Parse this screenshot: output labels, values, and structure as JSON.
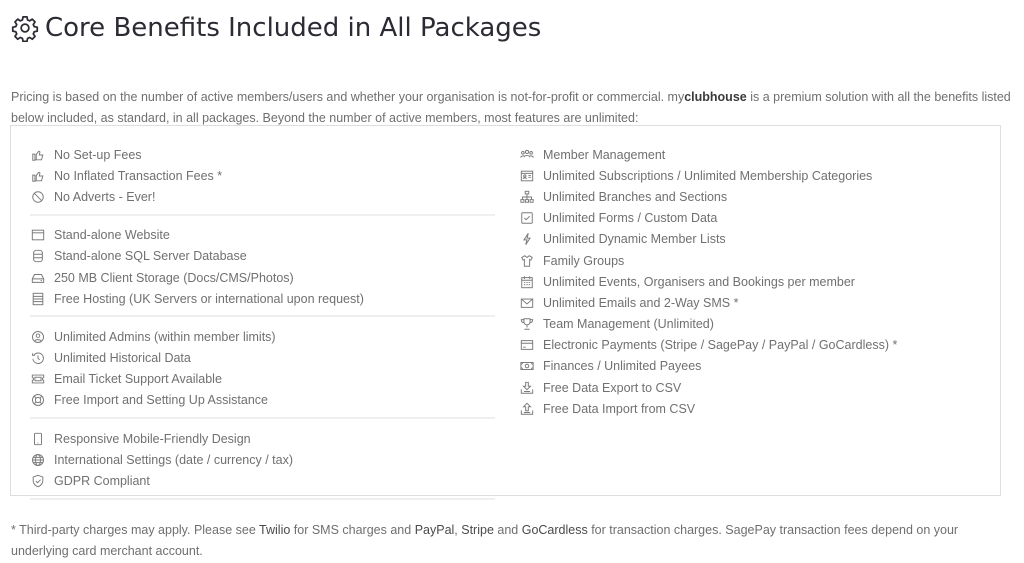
{
  "header": {
    "icon": "gear-icon",
    "title": "Core Benefits Included in All Packages"
  },
  "intro": {
    "part1": "Pricing is based on the number of active members/users and whether your organisation is not-for-profit or commercial. my",
    "brand": "clubhouse",
    "part2": " is a premium solution with all the benefits listed below included, as standard, in all packages. Beyond the number of active members, most features are unlimited:"
  },
  "left_column": {
    "groups": [
      {
        "items": [
          {
            "icon": "thumbs-up-icon",
            "label": "No Set-up Fees"
          },
          {
            "icon": "thumbs-up-icon",
            "label": "No Inflated Transaction Fees *"
          },
          {
            "icon": "ban-icon",
            "label": "No Adverts - Ever!"
          }
        ]
      },
      {
        "items": [
          {
            "icon": "browser-window-icon",
            "label": "Stand-alone Website"
          },
          {
            "icon": "database-icon",
            "label": "Stand-alone SQL Server Database"
          },
          {
            "icon": "hard-drive-icon",
            "label": "250 MB Client Storage (Docs/CMS/Photos)"
          },
          {
            "icon": "server-icon",
            "label": "Free Hosting (UK Servers or international upon request)"
          }
        ]
      },
      {
        "items": [
          {
            "icon": "user-circle-icon",
            "label": "Unlimited Admins (within member limits)"
          },
          {
            "icon": "history-icon",
            "label": "Unlimited Historical Data"
          },
          {
            "icon": "ticket-icon",
            "label": "Email Ticket Support Available"
          },
          {
            "icon": "lifebuoy-icon",
            "label": "Free Import and Setting Up Assistance"
          }
        ]
      },
      {
        "items": [
          {
            "icon": "mobile-icon",
            "label": "Responsive Mobile-Friendly Design"
          },
          {
            "icon": "globe-icon",
            "label": "International Settings (date / currency / tax)"
          },
          {
            "icon": "shield-check-icon",
            "label": "GDPR Compliant"
          }
        ]
      }
    ]
  },
  "right_column": {
    "items": [
      {
        "icon": "users-icon",
        "label": "Member Management"
      },
      {
        "icon": "id-card-icon",
        "label": "Unlimited Subscriptions / Unlimited Membership Categories"
      },
      {
        "icon": "sitemap-icon",
        "label": "Unlimited Branches and Sections"
      },
      {
        "icon": "checkbox-icon",
        "label": "Unlimited Forms / Custom Data"
      },
      {
        "icon": "bolt-icon",
        "label": "Unlimited Dynamic Member Lists"
      },
      {
        "icon": "shirt-icon",
        "label": "Family Groups"
      },
      {
        "icon": "calendar-icon",
        "label": "Unlimited Events, Organisers and Bookings per member"
      },
      {
        "icon": "envelope-icon",
        "label": "Unlimited Emails and 2-Way SMS *"
      },
      {
        "icon": "trophy-icon",
        "label": "Team Management (Unlimited)"
      },
      {
        "icon": "credit-card-icon",
        "label": "Electronic Payments (Stripe / SagePay / PayPal / GoCardless) *"
      },
      {
        "icon": "money-bill-icon",
        "label": "Finances / Unlimited Payees"
      },
      {
        "icon": "download-tray-icon",
        "label": "Free Data Export to CSV"
      },
      {
        "icon": "upload-tray-icon",
        "label": "Free Data Import from CSV"
      }
    ]
  },
  "footnote": {
    "t1": "* Third-party charges may apply. Please see ",
    "link_twilio": "Twilio",
    "t2": " for SMS charges and ",
    "link_paypal": "PayPal",
    "t3": ", ",
    "link_stripe": "Stripe",
    "t4": " and ",
    "link_gocardless": "GoCardless",
    "t5": " for transaction charges. SagePay transaction fees depend on your underlying card merchant account."
  }
}
